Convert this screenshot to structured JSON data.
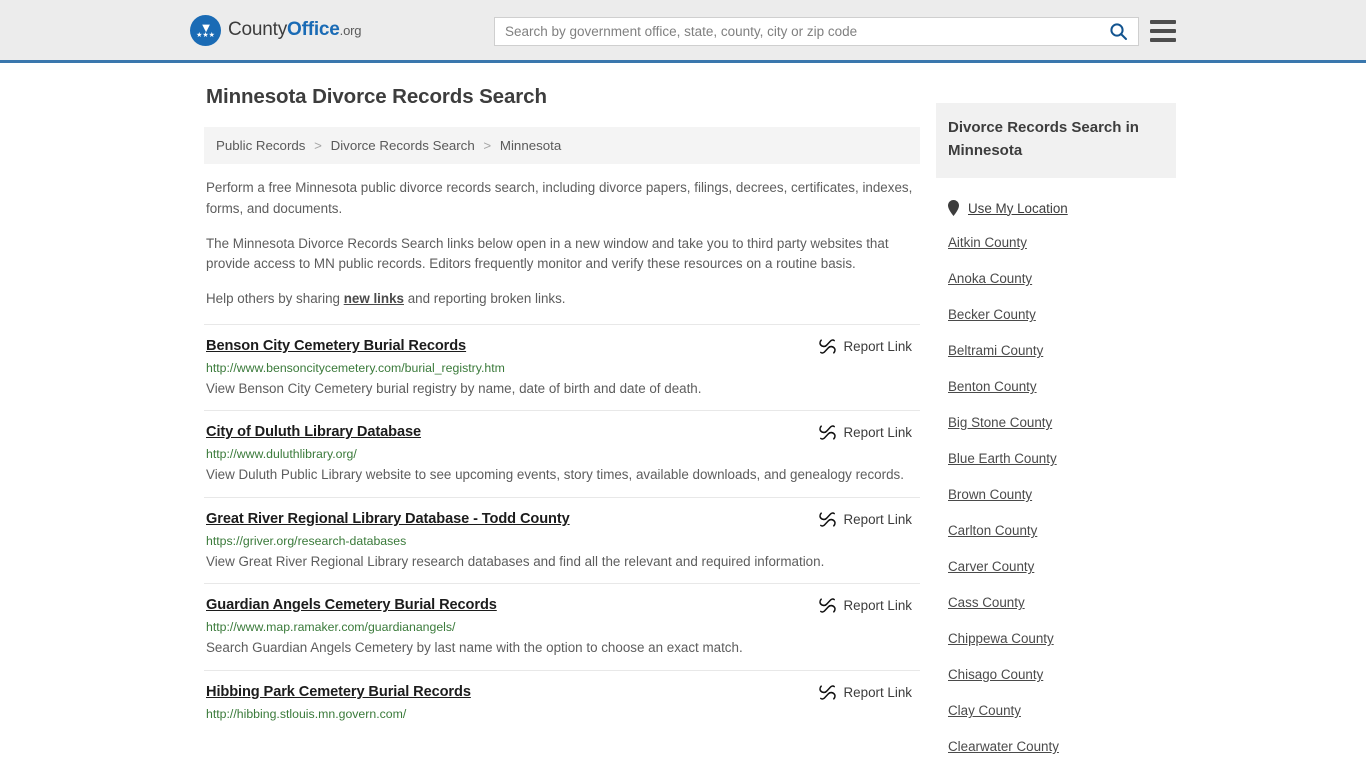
{
  "header": {
    "logo": {
      "part1": "County",
      "part2": "Office",
      "part3": ".org",
      "icon": "eagle-seal-icon"
    },
    "search": {
      "placeholder": "Search by government office, state, county, city or zip code",
      "value": ""
    },
    "search_icon": "search-icon",
    "menu_icon": "hamburger-menu-icon"
  },
  "main": {
    "title": "Minnesota Divorce Records Search",
    "breadcrumb": [
      {
        "label": "Public Records",
        "current": false
      },
      {
        "label": "Divorce Records Search",
        "current": false
      },
      {
        "label": "Minnesota",
        "current": true
      }
    ],
    "breadcrumb_separator": ">",
    "intro": {
      "p1": "Perform a free Minnesota public divorce records search, including divorce papers, filings, decrees, certificates, indexes, forms, and documents.",
      "p2": "The Minnesota Divorce Records Search links below open in a new window and take you to third party websites that provide access to MN public records. Editors frequently monitor and verify these resources on a routine basis.",
      "p3_before": "Help others by sharing ",
      "p3_link": "new links",
      "p3_after": " and reporting broken links."
    },
    "report_link_label": "Report Link",
    "report_link_icon": "broken-link-icon",
    "results": [
      {
        "title": "Benson City Cemetery Burial Records",
        "url": "http://www.bensoncitycemetery.com/burial_registry.htm",
        "description": "View Benson City Cemetery burial registry by name, date of birth and date of death."
      },
      {
        "title": "City of Duluth Library Database",
        "url": "http://www.duluthlibrary.org/",
        "description": "View Duluth Public Library website to see upcoming events, story times, available downloads, and genealogy records."
      },
      {
        "title": "Great River Regional Library Database - Todd County",
        "url": "https://griver.org/research-databases",
        "description": "View Great River Regional Library research databases and find all the relevant and required information."
      },
      {
        "title": "Guardian Angels Cemetery Burial Records",
        "url": "http://www.map.ramaker.com/guardianangels/",
        "description": "Search Guardian Angels Cemetery by last name with the option to choose an exact match."
      },
      {
        "title": "Hibbing Park Cemetery Burial Records",
        "url": "http://hibbing.stlouis.mn.govern.com/",
        "description": ""
      }
    ]
  },
  "sidebar": {
    "heading": "Divorce Records Search in Minnesota",
    "use_location_label": "Use My Location",
    "use_location_icon": "map-pin-icon",
    "counties": [
      "Aitkin County",
      "Anoka County",
      "Becker County",
      "Beltrami County",
      "Benton County",
      "Big Stone County",
      "Blue Earth County",
      "Brown County",
      "Carlton County",
      "Carver County",
      "Cass County",
      "Chippewa County",
      "Chisago County",
      "Clay County",
      "Clearwater County"
    ]
  },
  "colors": {
    "brand_blue": "#1a6bb5",
    "header_bg": "#ececec",
    "header_border": "#3a77ad",
    "url_green": "#3a7a3a",
    "panel_gray": "#f1f1f1"
  }
}
